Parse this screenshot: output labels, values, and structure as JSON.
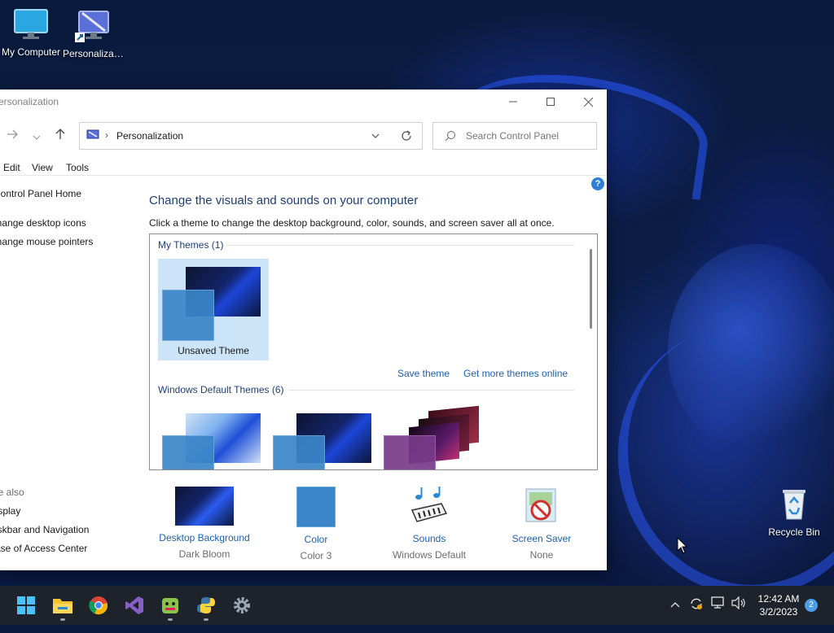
{
  "desktop": {
    "icons": [
      {
        "label": "My Computer",
        "icon": "monitor-icon"
      },
      {
        "label": "Personalizat...",
        "icon": "personalization-icon"
      }
    ],
    "recycle_bin": {
      "label": "Recycle Bin",
      "icon": "recycle-bin-icon"
    }
  },
  "window": {
    "title": "Personalization",
    "controls": {
      "minimize": "minimize-icon",
      "maximize": "maximize-icon",
      "close": "close-icon"
    },
    "address": {
      "location": "Personalization",
      "separator": "›"
    },
    "search": {
      "placeholder": "Search Control Panel"
    },
    "menu": [
      "Edit",
      "View",
      "Tools"
    ],
    "left_nav": [
      "Control Panel Home",
      "Change desktop icons",
      "Change mouse pointers"
    ],
    "see_also": {
      "header": "See also",
      "items": [
        "Display",
        "Taskbar and Navigation",
        "Ease of Access Center"
      ]
    },
    "heading": "Change the visuals and sounds on your computer",
    "subheading": "Click a theme to change the desktop background, color, sounds, and screen saver all at once.",
    "my_themes": {
      "header": "My Themes (1)",
      "items": [
        {
          "name": "Unsaved Theme",
          "selected": true
        }
      ]
    },
    "links": {
      "save_theme": "Save theme",
      "get_more": "Get more themes online"
    },
    "default_themes": {
      "header": "Windows Default Themes (6)"
    },
    "bottom": [
      {
        "title": "Desktop Background",
        "value": "Dark Bloom"
      },
      {
        "title": "Color",
        "value": "Color 3"
      },
      {
        "title": "Sounds",
        "value": "Windows Default"
      },
      {
        "title": "Screen Saver",
        "value": "None"
      }
    ],
    "help": "?"
  },
  "taskbar": {
    "apps": [
      "start-icon",
      "file-explorer-icon",
      "chrome-icon",
      "visual-studio-icon",
      "game-icon",
      "python-icon",
      "settings-icon"
    ],
    "clock": {
      "time": "12:42 AM",
      "date": "3/2/2023"
    },
    "notification_count": "2"
  },
  "colors": {
    "accent": "#1f5fa8",
    "heading": "#1f3f73",
    "selection": "#cce4f7",
    "taskbar": "#1e232b"
  }
}
